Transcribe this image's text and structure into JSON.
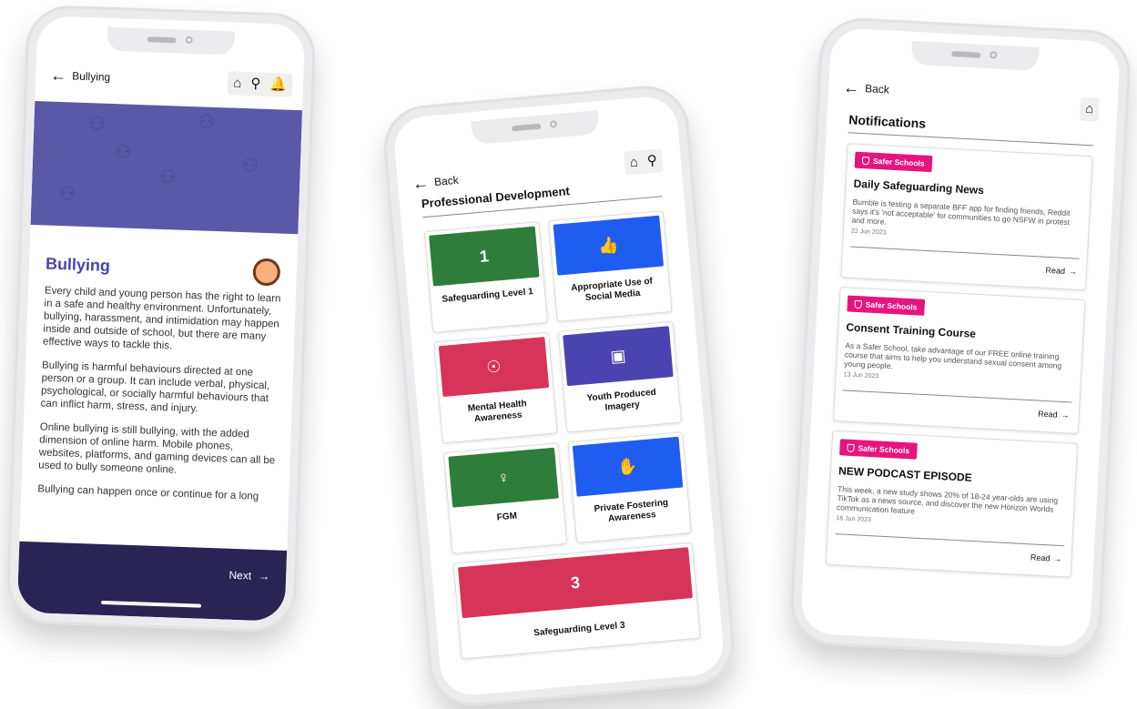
{
  "phone1": {
    "back_label": "Bullying",
    "nav_icons": [
      "home-icon",
      "search-icon",
      "bell-icon"
    ],
    "heading": "Bullying",
    "paragraphs": [
      "Every child and young person has the right to learn in a safe and healthy environment. Unfortunately, bullying, harassment, and intimidation may happen inside and outside of school, but there are many effective ways to tackle this.",
      "Bullying is harmful behaviours directed at one person or a group. It can include verbal, physical, psychological, or socially harmful behaviours that can inflict harm, stress, and injury.",
      "Online bullying is still bullying, with the added dimension of online harm. Mobile phones, websites, platforms, and gaming devices can all be used to bully someone online.",
      "Bullying can happen once or continue for a long"
    ],
    "next_label": "Next",
    "colors": {
      "hero": "#5b58a8",
      "heading": "#4744b0",
      "footer": "#2a2455"
    }
  },
  "phone2": {
    "back_label": "Back",
    "title": "Professional Development",
    "tiles": [
      {
        "label": "Safeguarding Level 1",
        "icon": "1",
        "color": "#2e7d3a"
      },
      {
        "label": "Appropriate Use of Social Media",
        "icon": "👍",
        "color": "#1f5cf0"
      },
      {
        "label": "Mental Health Awareness",
        "icon": "☉",
        "color": "#d7345a"
      },
      {
        "label": "Youth Produced Imagery",
        "icon": "▣",
        "color": "#4a43b0"
      },
      {
        "label": "FGM",
        "icon": "♀",
        "color": "#2e7d3a"
      },
      {
        "label": "Private Fostering Awareness",
        "icon": "✋",
        "color": "#1f5cf0"
      },
      {
        "label": "Safeguarding Level 3",
        "icon": "3",
        "color": "#d7345a"
      }
    ]
  },
  "phone3": {
    "back_label": "Back",
    "title": "Notifications",
    "cards": [
      {
        "badge": "Safer Schools",
        "title": "Daily Safeguarding News",
        "body": "Bumble is testing a separate BFF app for finding friends, Reddit says it's 'not acceptable' for communities to go NSFW in protest and more.",
        "date": "22 Jun 2023",
        "read": "Read"
      },
      {
        "badge": "Safer Schools",
        "title": "Consent Training Course",
        "body": "As a Safer School, take advantage of our FREE online training course that aims to help you understand sexual consent among young people.",
        "date": "13 Jun 2023",
        "read": "Read"
      },
      {
        "badge": "Safer Schools",
        "title": "NEW PODCAST EPISODE",
        "body": "This week, a new study shows 20% of 18-24 year-olds are using TikTok as a news source, and discover the new Horizon Worlds communication feature",
        "date": "16 Jun 2023",
        "read": "Read"
      }
    ],
    "badge_color": "#e6157e"
  }
}
